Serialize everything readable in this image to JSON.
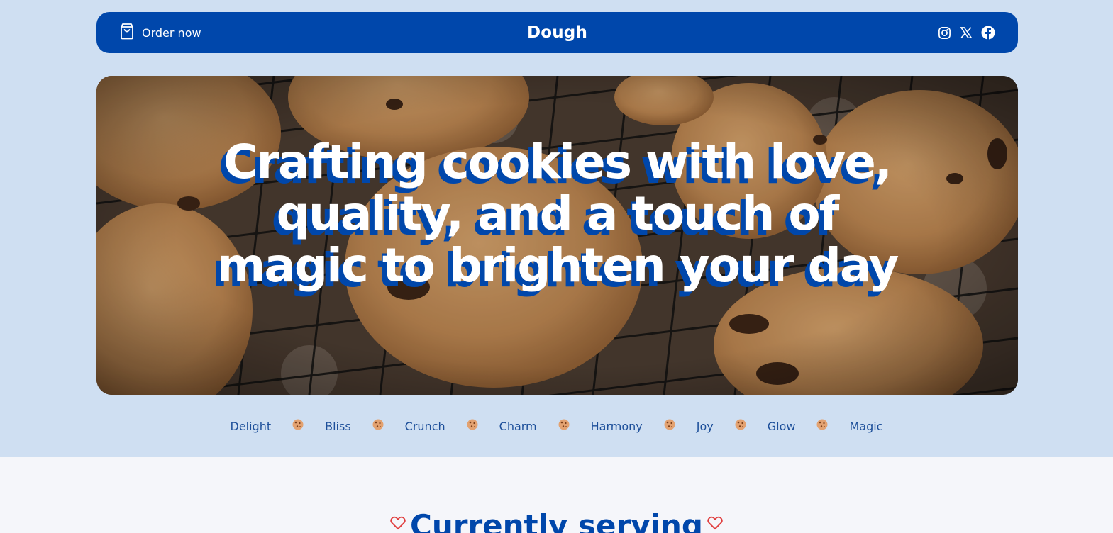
{
  "nav": {
    "order_label": "Order now",
    "brand": "Dough",
    "socials": [
      "instagram-icon",
      "x-icon",
      "facebook-icon"
    ]
  },
  "hero": {
    "title": "Crafting cookies with love, quality, and a touch of magic to brighten your day",
    "image": "cookies-on-cooling-rack"
  },
  "ticker": {
    "words": [
      "Delight",
      "Bliss",
      "Crunch",
      "Charm",
      "Harmony",
      "Joy",
      "Glow",
      "Magic"
    ],
    "separator_icon": "cookie-icon"
  },
  "section": {
    "title": "Currently serving",
    "decor_icon": "heart-icon"
  },
  "colors": {
    "primary": "#0047ab",
    "page_bg": "#cfdff2",
    "section_bg": "#f5f6fa",
    "heart": "#e03c3c"
  }
}
